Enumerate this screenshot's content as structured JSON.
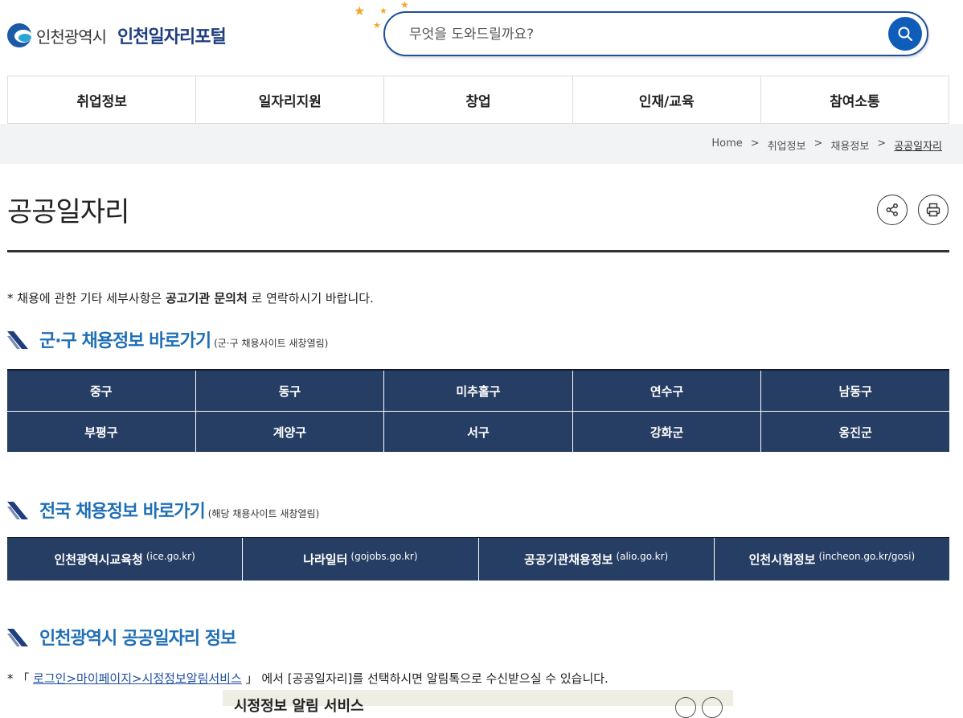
{
  "header": {
    "city_name": "인천광역시",
    "portal_name": "인천일자리포털",
    "search_placeholder": "무엇을 도와드릴까요?"
  },
  "nav": {
    "items": [
      "취업정보",
      "일자리지원",
      "창업",
      "인재/교육",
      "참여소통"
    ]
  },
  "breadcrumb": {
    "items": [
      "Home",
      ">",
      "취업정보",
      ">",
      "채용정보",
      ">",
      "공공일자리"
    ]
  },
  "page": {
    "title": "공공일자리",
    "note_prefix": "* 채용에 관한 기타 세부사항은 ",
    "note_bold": "공고기관 문의처",
    "note_suffix": " 로 연락하시기 바랍니다."
  },
  "section_district": {
    "title": "군·구 채용정보 바로가기",
    "subtitle": "(군·구 채용사이트 새창열림)",
    "rows": [
      [
        "중구",
        "동구",
        "미추홀구",
        "연수구",
        "남동구"
      ],
      [
        "부평구",
        "계양구",
        "서구",
        "강화군",
        "옹진군"
      ]
    ]
  },
  "section_national": {
    "title": "전국 채용정보 바로가기",
    "subtitle": "(해당 채용사이트 새창열림)",
    "links": [
      {
        "label": "인천광역시교육청",
        "domain": "(ice.go.kr)"
      },
      {
        "label": "나라일터",
        "domain": "(gojobs.go.kr)"
      },
      {
        "label": "공공기관채용정보",
        "domain": "(alio.go.kr)"
      },
      {
        "label": "인천시험정보",
        "domain": "(incheon.go.kr/gosi)"
      }
    ]
  },
  "section_incheon": {
    "title": "인천광역시 공공일자리 정보",
    "note_prefix": "* 「 ",
    "note_link": "로그인>마이페이지>시정정보알림서비스",
    "note_suffix": " 」 에서 [공공일자리]를 선택하시면 알림톡으로 수신받으실 수 있습니다.",
    "preview_title": "시정정보 알림 서비스"
  },
  "colors": {
    "accent_blue": "#1f6fb5",
    "table_navy": "#263e63",
    "search_border": "#1f4e9a",
    "star_orange": "#f2a826"
  }
}
